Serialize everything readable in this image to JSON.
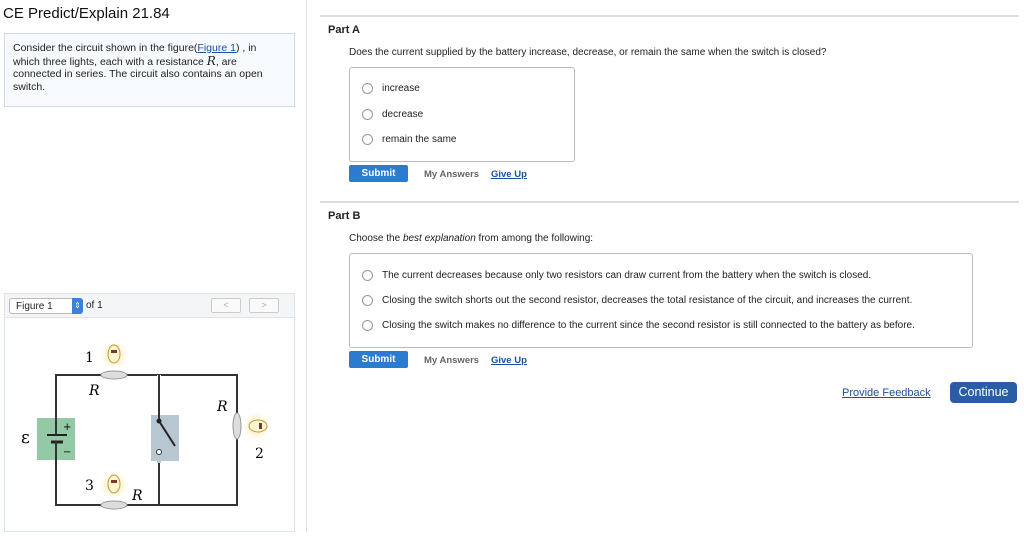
{
  "header": {
    "title": "CE Predict/Explain 21.84"
  },
  "intro": {
    "text_before": "Consider the circuit shown in the figure(",
    "link": "Figure 1",
    "text_mid": ") , in which three lights, each with a resistance ",
    "var": "R",
    "text_after": ", are connected in series. The circuit also contains an open switch."
  },
  "figure": {
    "selected": "Figure 1",
    "of_label": "of 1",
    "prev": "<",
    "next": ">",
    "labels": {
      "emf": "ε",
      "plus": "+",
      "minus": "−",
      "bulb1": "1",
      "bulb2": "2",
      "bulb3": "3",
      "r1": "R",
      "r2": "R",
      "r3": "R"
    }
  },
  "partA": {
    "label": "Part A",
    "question": "Does the current supplied by the battery increase, decrease, or remain the same when the switch is closed?",
    "options": [
      "increase",
      "decrease",
      "remain the same"
    ],
    "submit": "Submit",
    "my_answers": "My Answers",
    "give_up": "Give Up"
  },
  "partB": {
    "label": "Part B",
    "q_before": "Choose the ",
    "q_em": "best explanation",
    "q_after": " from among the following:",
    "options": [
      "The current decreases because only two resistors can draw current from the battery when the switch is closed.",
      "Closing the switch shorts out the second resistor, decreases the total resistance of the circuit, and increases the current.",
      "Closing the switch makes no difference to the current since the second resistor is still connected to the battery as before."
    ],
    "submit": "Submit",
    "my_answers": "My Answers",
    "give_up": "Give Up"
  },
  "footer": {
    "feedback": "Provide Feedback",
    "continue": "Continue"
  }
}
